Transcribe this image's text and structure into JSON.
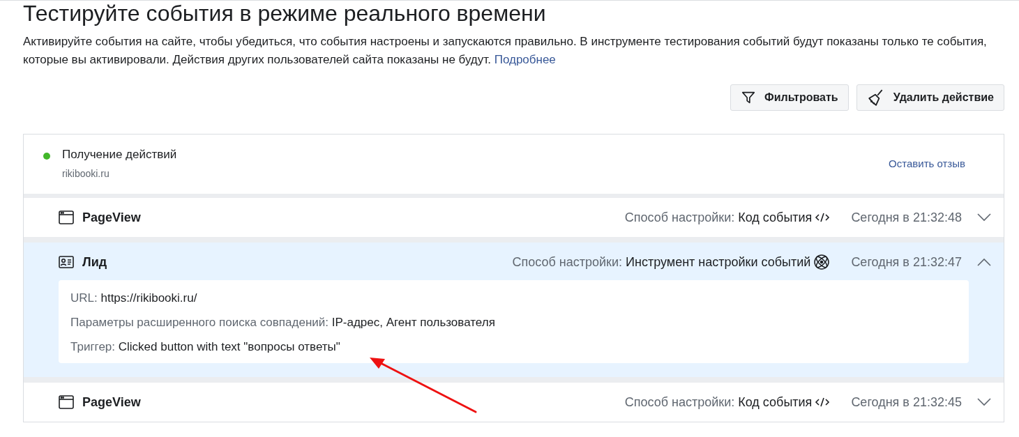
{
  "title": "Тестируйте события в режиме реального времени",
  "description": "Активируйте события на сайте, чтобы убедиться, что события настроены и запускаются правильно. В инструменте тестирования событий будут показаны только те события, которые вы активировали. Действия других пользователей сайта показаны не будут.",
  "learn_more": "Подробнее",
  "toolbar": [
    {
      "kind": "filter",
      "label": "Фильтровать"
    },
    {
      "kind": "clear",
      "label": "Удалить действие"
    }
  ],
  "status": {
    "label": "Получение действий",
    "site": "rikibooki.ru",
    "active": true,
    "feedback": "Оставить отзыв"
  },
  "events": [
    {
      "kind": "pageview",
      "name": "PageView",
      "method_label": "Способ настройки:",
      "method": {
        "kind": "code",
        "text": "Код события"
      },
      "time": "Сегодня в 21:32:48",
      "expanded": false
    },
    {
      "kind": "lead",
      "name": "Лид",
      "method_label": "Способ настройки:",
      "method": {
        "kind": "tool",
        "text": "Инструмент настройки событий"
      },
      "time": "Сегодня в 21:32:47",
      "expanded": true,
      "details": [
        {
          "label": "URL:",
          "value": "https://rikibooki.ru/"
        },
        {
          "label": "Параметры расширенного поиска совпадений:",
          "value": "IP-адрес, Агент пользователя"
        },
        {
          "label": "Триггер:",
          "value": "Clicked button with text \"вопросы ответы\""
        }
      ]
    },
    {
      "kind": "pageview",
      "name": "PageView",
      "method_label": "Способ настройки:",
      "method": {
        "kind": "code",
        "text": "Код события"
      },
      "time": "Сегодня в 21:32:45",
      "expanded": false
    }
  ]
}
